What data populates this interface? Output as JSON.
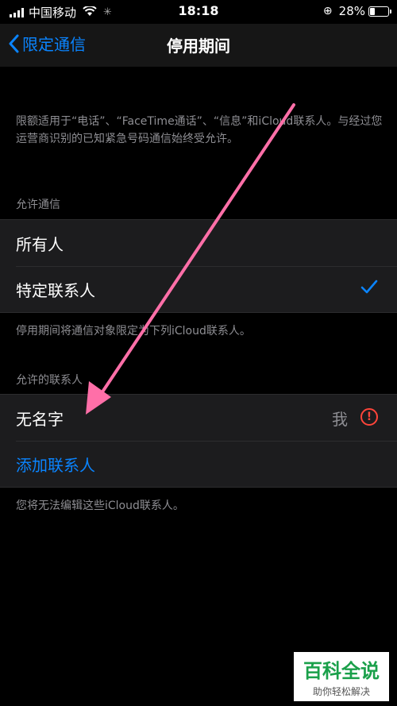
{
  "status_bar": {
    "carrier": "中国移动",
    "time": "18:18",
    "battery_percent": "28%",
    "battery_level": 0.28
  },
  "nav": {
    "back_label": "限定通信",
    "title": "停用期间"
  },
  "description": "限额适用于“电话”、“FaceTime通话”、“信息”和iCloud联系人。与经过您运营商识别的已知紧急号码通信始终受允许。",
  "allow_communication": {
    "header": "允许通信",
    "options": [
      {
        "label": "所有人",
        "selected": false
      },
      {
        "label": "特定联系人",
        "selected": true
      }
    ],
    "footer": "停用期间将通信对象限定为下列iCloud联系人。"
  },
  "allowed_contacts": {
    "header": "允许的联系人",
    "contact_name": "无名字",
    "contact_tag": "我",
    "add_label": "添加联系人",
    "footer": "您将无法编辑这些iCloud联系人。"
  },
  "watermark": {
    "main": "百科全说",
    "sub": "助你轻松解决"
  },
  "colors": {
    "accent": "#0a84ff",
    "warning": "#ff453a",
    "annotation_arrow": "#ff6fa8"
  }
}
